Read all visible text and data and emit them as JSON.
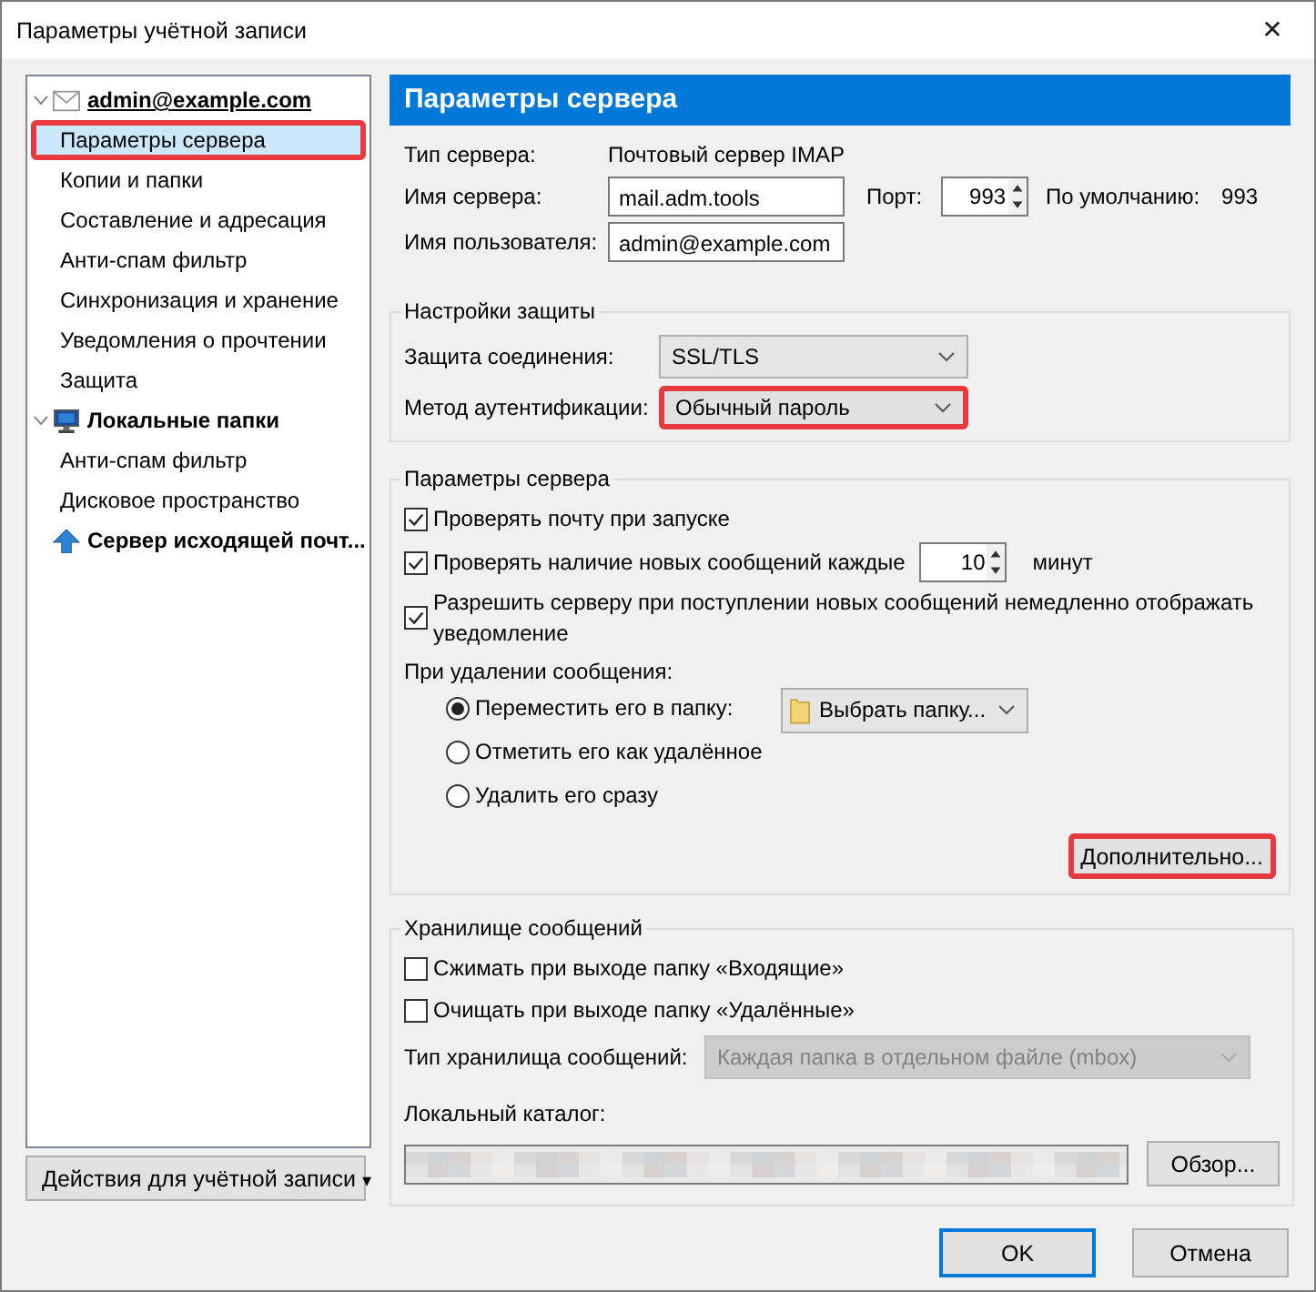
{
  "window": {
    "title": "Параметры учётной записи",
    "close": "✕"
  },
  "tree": [
    {
      "label": "admin@example.com",
      "kind": "mail",
      "expanded": true,
      "children": [
        {
          "label": "Параметры сервера",
          "selected": true,
          "highlighted": true
        },
        {
          "label": "Копии и папки",
          "selected": false,
          "highlighted": false
        },
        {
          "label": "Составление и адресация",
          "selected": false,
          "highlighted": false
        },
        {
          "label": "Анти-спам фильтр",
          "selected": false,
          "highlighted": false
        },
        {
          "label": "Синхронизация и хранение",
          "selected": false,
          "highlighted": false
        },
        {
          "label": "Уведомления о прочтении",
          "selected": false,
          "highlighted": false
        },
        {
          "label": "Защита",
          "selected": false,
          "highlighted": false
        }
      ]
    },
    {
      "label": "Локальные папки",
      "kind": "computer",
      "expanded": true,
      "children": [
        {
          "label": "Анти-спам фильтр",
          "selected": false,
          "highlighted": false
        },
        {
          "label": "Дисковое пространство",
          "selected": false,
          "highlighted": false
        }
      ]
    },
    {
      "label": "Сервер исходящей почт...",
      "kind": "outgoing"
    }
  ],
  "account_actions": {
    "label": "Действия для учётной записи",
    "caret": "▾"
  },
  "panel_title": "Параметры сервера",
  "server_type": {
    "label": "Тип сервера:",
    "value": "Почтовый сервер IMAP"
  },
  "server_name": {
    "label": "Имя сервера:",
    "value": "mail.adm.tools"
  },
  "port": {
    "label": "Порт:",
    "value": "993",
    "default_label": "По умолчанию:",
    "default_value": "993"
  },
  "user_name": {
    "label": "Имя пользователя:",
    "value": "admin@example.com"
  },
  "security": {
    "title": "Настройки защиты",
    "rows": [
      {
        "label": "Защита соединения:",
        "value": "SSL/TLS",
        "highlighted": false
      },
      {
        "label": "Метод аутентификации:",
        "value": "Обычный пароль",
        "highlighted": true
      }
    ]
  },
  "server_settings": {
    "title": "Параметры сервера",
    "check_on_start": {
      "label": "Проверять почту при запуске",
      "checked": true
    },
    "check_every": {
      "label": "Проверять наличие новых сообщений каждые",
      "checked": true,
      "value": "10",
      "unit": "минут"
    },
    "allow_notify": {
      "label": "Разрешить серверу при поступлении новых сообщений немедленно отображать уведомление",
      "checked": true
    },
    "on_delete": {
      "label": "При удалении сообщения:",
      "options": [
        {
          "label": "Переместить его в папку:",
          "selected": true
        },
        {
          "label": "Отметить его как удалённое",
          "selected": false
        },
        {
          "label": "Удалить его сразу",
          "selected": false
        }
      ],
      "folder": "Выбрать папку..."
    },
    "advanced": {
      "label": "Дополнительно...",
      "highlighted": true
    }
  },
  "storage": {
    "title": "Хранилище сообщений",
    "checks": [
      {
        "label": "Сжимать при выходе папку «Входящие»",
        "checked": false
      },
      {
        "label": "Очищать при выходе папку «Удалённые»",
        "checked": false
      }
    ],
    "type": {
      "label": "Тип хранилища сообщений:",
      "value": "Каждая папка в отдельном файле (mbox)",
      "disabled": true
    },
    "local_dir": {
      "label": "Локальный каталог:",
      "browse": "Обзор..."
    }
  },
  "buttons": [
    {
      "label": "OK",
      "default": true
    },
    {
      "label": "Отмена",
      "default": false
    }
  ]
}
